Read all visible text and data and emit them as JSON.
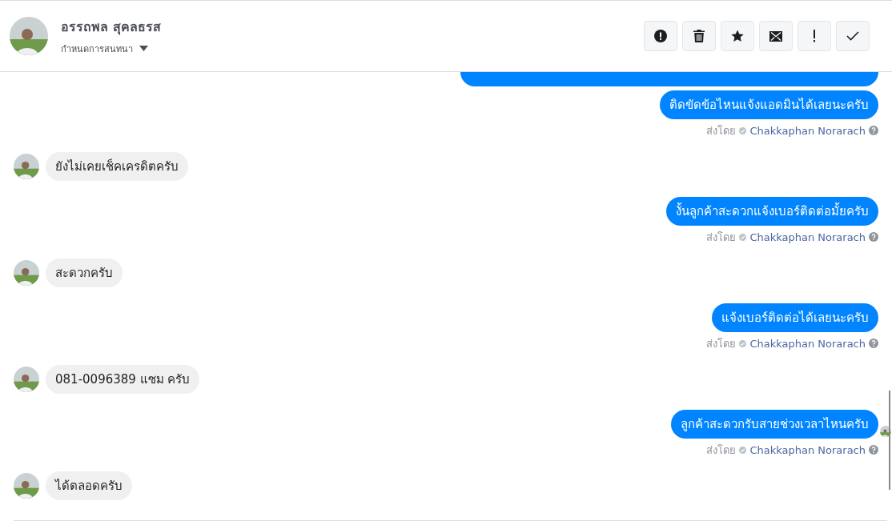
{
  "header": {
    "contact_name": "อรรถพล สุคลธรส",
    "subtitle": "กำหนดการสนทนา"
  },
  "actions": [
    {
      "kind": "alert"
    },
    {
      "kind": "trash"
    },
    {
      "kind": "star"
    },
    {
      "kind": "mail"
    },
    {
      "kind": "exclaim"
    },
    {
      "kind": "check"
    }
  ],
  "messages": [
    {
      "kind": "outgoing"
    },
    {
      "kind": "outgoing",
      "text": "ติดขัดข้อไหนแจ้งแอดมินได้เลยนะครับ",
      "sent_by_label": "ส่งโดย",
      "sender": "Chakkaphan Norarach",
      "seen": false
    },
    {
      "kind": "incoming",
      "text": "ยังไม่เคยเช็คเครดิตครับ"
    },
    {
      "kind": "outgoing",
      "text": "งั้นลูกค้าสะดวกแจ้งเบอร์ติดต่อมั้ยครับ",
      "sent_by_label": "ส่งโดย",
      "sender": "Chakkaphan Norarach",
      "seen": false
    },
    {
      "kind": "incoming",
      "text": "สะดวกครับ"
    },
    {
      "kind": "outgoing",
      "text": "แจ้งเบอร์ติดต่อได้เลยนะครับ",
      "sent_by_label": "ส่งโดย",
      "sender": "Chakkaphan Norarach",
      "seen": false
    },
    {
      "kind": "incoming",
      "text": "081-0096389 แซม ครับ"
    },
    {
      "kind": "outgoing",
      "text": "ลูกค้าสะดวกรับสายช่วงเวลาไหนครับ",
      "sent_by_label": "ส่งโดย",
      "sender": "Chakkaphan Norarach",
      "seen": true
    },
    {
      "kind": "incoming",
      "text": "ได้ตลอดครับ"
    }
  ]
}
